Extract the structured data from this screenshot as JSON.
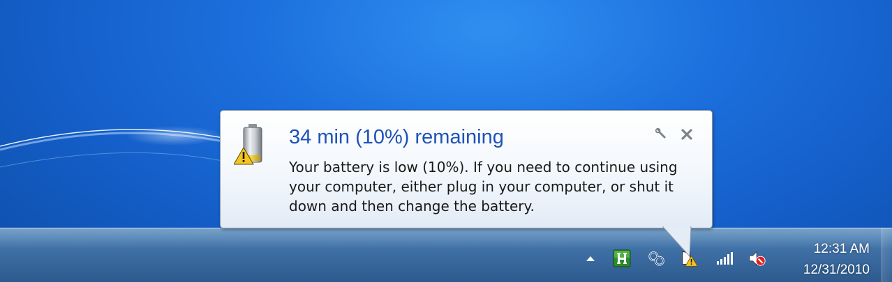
{
  "notification": {
    "title": "34 min (10%) remaining",
    "body_lines": [
      "Your battery is low (10%). If you need to continue using",
      "your computer, either plug in your computer, or shut it",
      "down and then change the battery."
    ],
    "icon": "battery-low-warning-icon",
    "options_icon": "wrench-icon",
    "close_icon": "close-icon",
    "title_color": "#1e53b8"
  },
  "taskbar": {
    "tray_icons": [
      "show-hidden-icons-arrow-icon",
      "h-app-icon",
      "network-connection-icon",
      "battery-warning-icon",
      "signal-bars-icon",
      "volume-muted-icon"
    ],
    "clock": {
      "time": "12:31 AM",
      "date": "12/31/2010"
    }
  }
}
